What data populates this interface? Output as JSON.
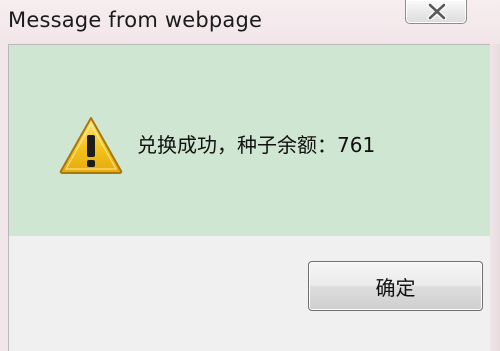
{
  "window": {
    "title": "Message from webpage",
    "close_icon": "close-x-icon"
  },
  "message": {
    "icon": "warning-triangle-icon",
    "text": "兑换成功，种子余额：761"
  },
  "buttons": {
    "ok_label": "确定"
  },
  "colors": {
    "message_background": "#cfe6d2",
    "button_area_background": "#f0f0f0",
    "warning_yellow": "#f4c21b"
  }
}
